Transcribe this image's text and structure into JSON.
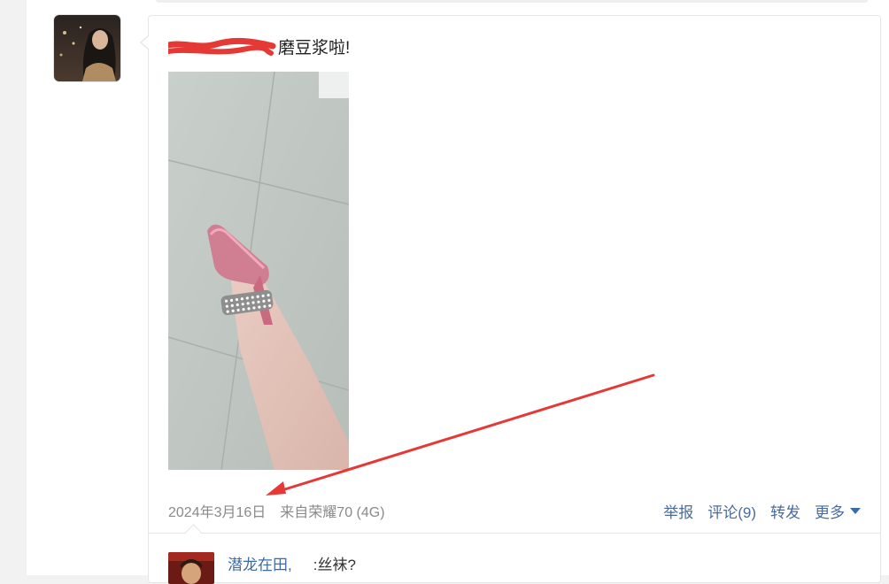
{
  "post": {
    "text": "磨豆浆啦!",
    "date": "2024年3月16日",
    "source": "来自荣耀70 (4G)"
  },
  "actions": {
    "report": "举报",
    "comment": "评论(9)",
    "forward": "转发",
    "more": "更多"
  },
  "comment": {
    "user": "潜龙在田,",
    "text": ":丝袜?"
  },
  "colors": {
    "link_blue": "#4a6b9c",
    "annotation_red": "#e53935"
  },
  "icons": {
    "more": "chevron-down-icon"
  }
}
